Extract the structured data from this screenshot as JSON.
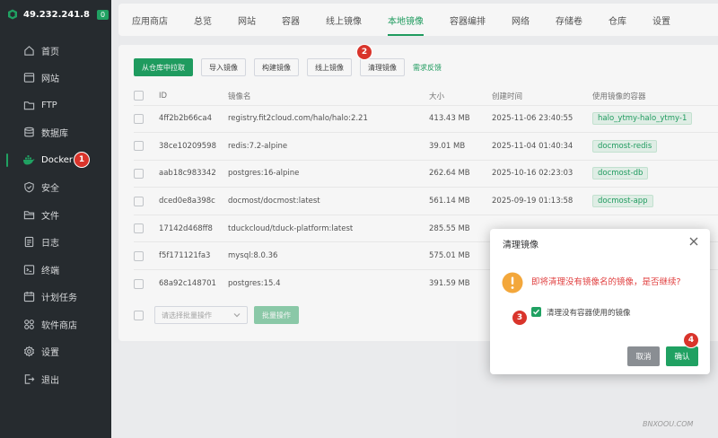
{
  "sidebar": {
    "ip": "49.232.241.8",
    "badge": "0",
    "items": [
      {
        "label": "首页",
        "icon": "home-icon"
      },
      {
        "label": "网站",
        "icon": "website-icon"
      },
      {
        "label": "FTP",
        "icon": "folder-icon"
      },
      {
        "label": "数据库",
        "icon": "database-icon"
      },
      {
        "label": "Docker",
        "icon": "docker-icon",
        "active": true
      },
      {
        "label": "安全",
        "icon": "shield-icon"
      },
      {
        "label": "文件",
        "icon": "file-folder-icon"
      },
      {
        "label": "日志",
        "icon": "log-icon"
      },
      {
        "label": "终端",
        "icon": "terminal-icon"
      },
      {
        "label": "计划任务",
        "icon": "calendar-icon"
      },
      {
        "label": "软件商店",
        "icon": "apps-icon"
      },
      {
        "label": "设置",
        "icon": "gear-icon"
      },
      {
        "label": "退出",
        "icon": "logout-icon"
      }
    ]
  },
  "topnav": {
    "tabs": [
      "应用商店",
      "总览",
      "网站",
      "容器",
      "线上镜像",
      "本地镜像",
      "容器编排",
      "网络",
      "存储卷",
      "仓库",
      "设置"
    ],
    "active": "本地镜像"
  },
  "toolbar": {
    "pull": "从仓库中拉取",
    "import": "导入镜像",
    "build": "构建镜像",
    "online": "线上镜像",
    "clean": "清理镜像",
    "feedback": "需求反馈"
  },
  "table": {
    "headers": {
      "id": "ID",
      "name": "镜像名",
      "size": "大小",
      "created": "创建时间",
      "used_by": "使用镜像的容器"
    },
    "rows": [
      {
        "id": "4ff2b2b66ca4",
        "name": "registry.fit2cloud.com/halo/halo:2.21",
        "size": "413.43 MB",
        "created": "2025-11-06 23:40:55",
        "container": "halo_ytmy-halo_ytmy-1"
      },
      {
        "id": "38ce10209598",
        "name": "redis:7.2-alpine",
        "size": "39.01 MB",
        "created": "2025-11-04 01:40:34",
        "container": "docmost-redis"
      },
      {
        "id": "aab18c983342",
        "name": "postgres:16-alpine",
        "size": "262.64 MB",
        "created": "2025-10-16 02:23:03",
        "container": "docmost-db"
      },
      {
        "id": "dced0e8a398c",
        "name": "docmost/docmost:latest",
        "size": "561.14 MB",
        "created": "2025-09-19 01:13:58",
        "container": "docmost-app"
      },
      {
        "id": "17142d468ff8",
        "name": "tduckcloud/tduck-platform:latest",
        "size": "285.55 MB",
        "created": "",
        "container": ""
      },
      {
        "id": "f5f171121fa3",
        "name": "mysql:8.0.36",
        "size": "575.01 MB",
        "created": "",
        "container": ""
      },
      {
        "id": "68a92c148701",
        "name": "postgres:15.4",
        "size": "391.59 MB",
        "created": "",
        "container": ""
      }
    ]
  },
  "batch": {
    "placeholder": "请选择批量操作",
    "button": "批量操作"
  },
  "dialog": {
    "title": "清理镜像",
    "message": "即将清理没有镜像名的镜像，是否继续?",
    "checkbox_label": "清理没有容器使用的镜像",
    "checkbox_checked": true,
    "cancel": "取消",
    "confirm": "确认"
  },
  "steps": [
    "1",
    "2",
    "3",
    "4"
  ],
  "watermark": "BNXOOU.COM",
  "colors": {
    "accent": "#20a162",
    "danger": "#e03f3f",
    "sidebar_bg": "#262b2f",
    "step": "#d9342b"
  }
}
